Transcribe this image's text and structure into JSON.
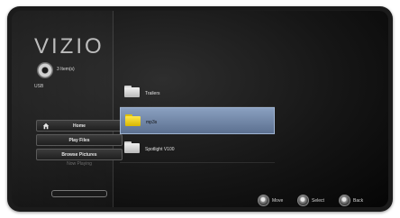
{
  "sidebar": {
    "logo": "VIZIO",
    "item_count": "3 Item(s)",
    "source": "USB",
    "buttons": {
      "home": "Home",
      "play_files": "Play Files",
      "browse_pictures": "Browse Pictures"
    },
    "now_playing": "Now Playing"
  },
  "files": [
    {
      "name": "Trailers",
      "selected": false
    },
    {
      "name": "mp3s",
      "selected": true
    },
    {
      "name": "Spotlight V100",
      "selected": false
    }
  ],
  "hints": {
    "move": "Move",
    "select": "Select",
    "back": "Back"
  },
  "colors": {
    "selection": "#7a90b0",
    "folder_selected": "#ffe84a"
  }
}
